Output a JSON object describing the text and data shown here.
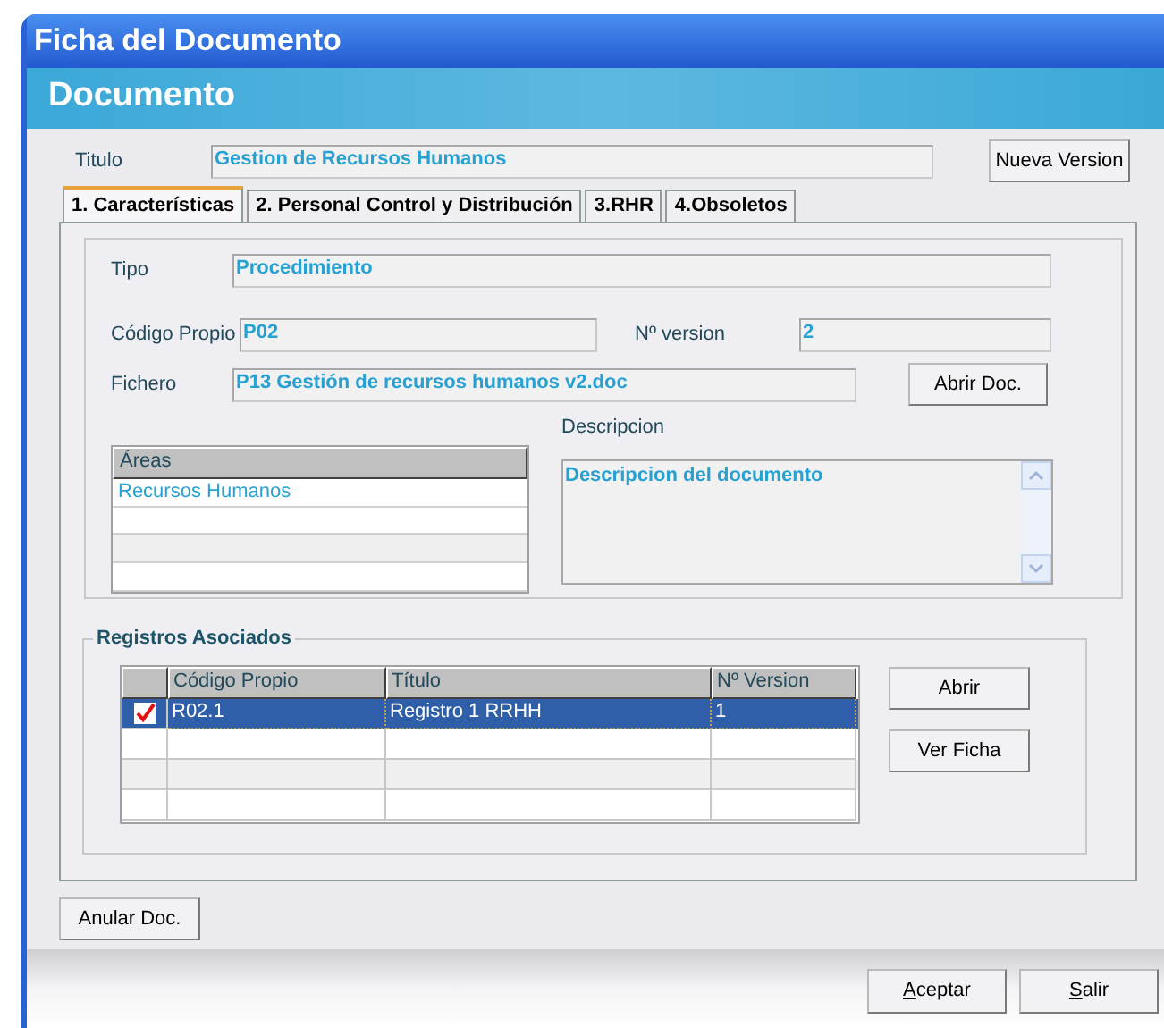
{
  "window": {
    "title": "Ficha del Documento"
  },
  "banner": {
    "title": "Documento"
  },
  "titulo": {
    "label": "Titulo",
    "value": "Gestion de Recursos Humanos"
  },
  "nueva_version_button": "Nueva Version",
  "tabs": [
    {
      "label": "1. Características",
      "selected": true
    },
    {
      "label": "2. Personal Control y Distribución",
      "selected": false
    },
    {
      "label": "3.RHR",
      "selected": false
    },
    {
      "label": "4.Obsoletos",
      "selected": false
    }
  ],
  "tipo": {
    "label": "Tipo",
    "value": "Procedimiento"
  },
  "codigo_propio": {
    "label": "Código Propio",
    "value": "P02"
  },
  "n_version": {
    "label": "Nº version",
    "value": "2"
  },
  "fichero": {
    "label": "Fichero",
    "value": "P13 Gestión de recursos humanos v2.doc"
  },
  "abrir_doc_button": "Abrir Doc.",
  "areas": {
    "header": "Áreas",
    "rows": [
      "Recursos Humanos"
    ]
  },
  "descripcion": {
    "label": "Descripcion",
    "value": "Descripcion del documento"
  },
  "registros": {
    "title": "Registros Asociados",
    "columns": [
      "Código Propio",
      "Título",
      "Nº Version"
    ],
    "rows": [
      {
        "checked": true,
        "selected": true,
        "cells": [
          "R02.1",
          "Registro 1 RRHH",
          "1"
        ]
      }
    ],
    "buttons": [
      "Abrir",
      "Ver Ficha"
    ]
  },
  "anular_button": "Anular Doc.",
  "footer_buttons": [
    {
      "access_key": "A",
      "label_rest": "ceptar"
    },
    {
      "access_key": "S",
      "label_rest": "alir"
    }
  ]
}
